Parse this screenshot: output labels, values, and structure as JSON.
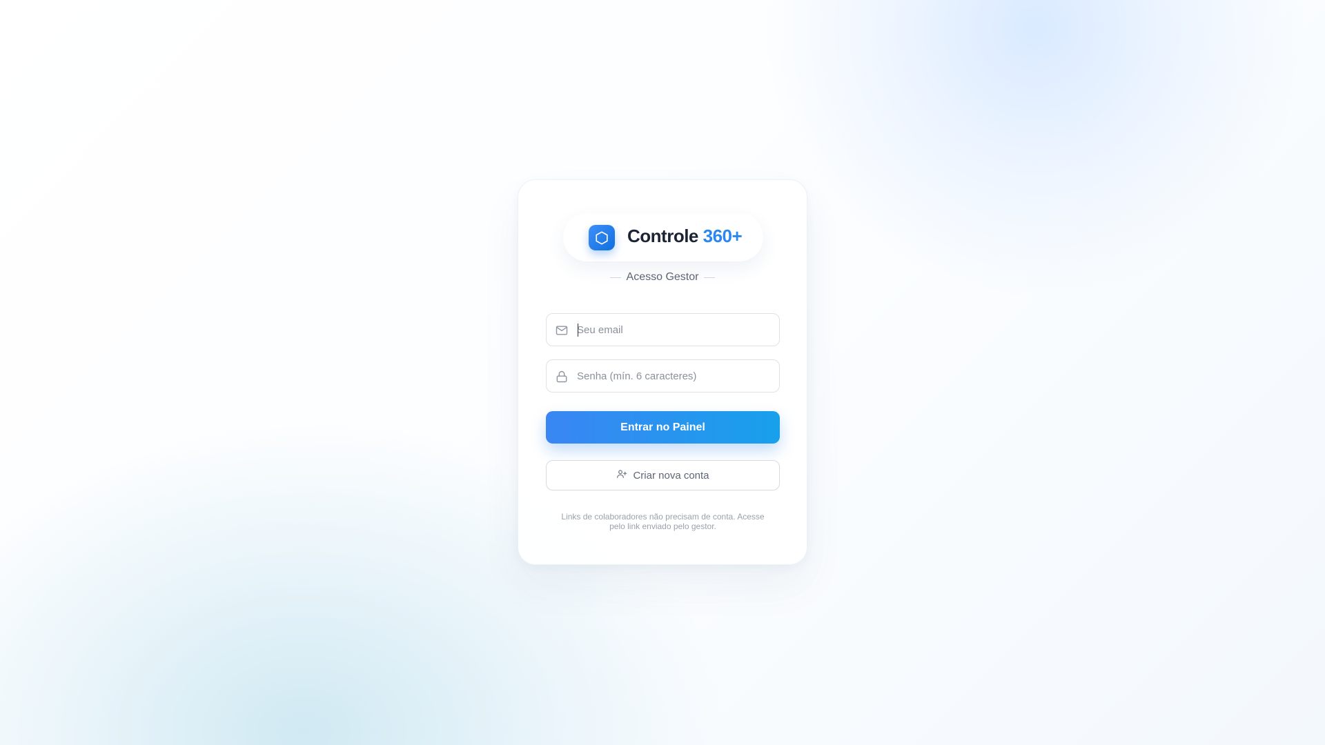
{
  "brand": {
    "name": "Controle",
    "accent": "360+",
    "logo_icon": "hexagon-icon"
  },
  "subtitle": "Acesso Gestor",
  "form": {
    "email_placeholder": "Seu email",
    "email_value": "",
    "email_icon": "mail-icon",
    "password_placeholder": "Senha (mín. 6 caracteres)",
    "password_value": "",
    "password_icon": "lock-icon"
  },
  "buttons": {
    "primary_label": "Entrar no Painel",
    "secondary_label": "Criar nova conta",
    "secondary_icon": "user-plus-icon"
  },
  "footnote": "Links de colaboradores não precisam de conta. Acesse pelo link enviado pelo gestor.",
  "colors": {
    "accent": "#2b86ee",
    "primary_gradient_start": "#3a86f3",
    "primary_gradient_end": "#18a0eb",
    "title": "#1c2333"
  }
}
